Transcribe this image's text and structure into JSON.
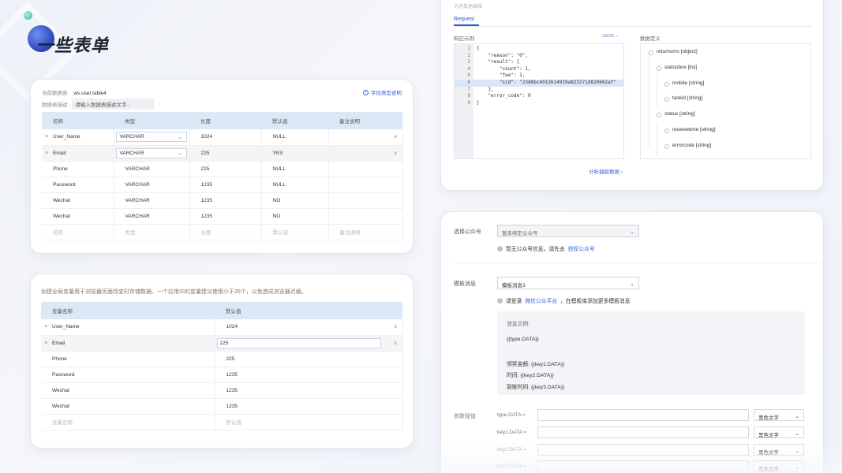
{
  "page": {
    "title": "一些表单"
  },
  "table_form": {
    "current_table_label": "当前数据表:",
    "current_table_value": "ws.user.table4",
    "desc_label": "数据表描述:",
    "desc_placeholder": "请输入数据表描述文字...",
    "help_link": "字段类型说明",
    "columns": [
      "名称",
      "类型",
      "长度",
      "默认值",
      "备注说明"
    ],
    "rows": [
      {
        "name": "User_Name",
        "type": "VARCHAR",
        "length": "1024",
        "default": "NULL",
        "note": ""
      },
      {
        "name": "Email",
        "type": "VARCHAR",
        "length": "225",
        "default": "YES",
        "note": ""
      },
      {
        "name": "Phone",
        "type": "VARCHAR",
        "length": "225",
        "default": "NULL",
        "note": ""
      },
      {
        "name": "Password",
        "type": "VARCHAR",
        "length": "1235",
        "default": "NULL",
        "note": ""
      },
      {
        "name": "Wechat",
        "type": "VARCHAR",
        "length": "1235",
        "default": "NO",
        "note": ""
      },
      {
        "name": "Wechat",
        "type": "VARCHAR",
        "length": "1235",
        "default": "NO",
        "note": ""
      }
    ],
    "placeholder_row": [
      "名称",
      "类型",
      "长度",
      "默认值",
      "备注说明"
    ]
  },
  "vars_form": {
    "note": "创建全局变量用于浏览器页面改变时存储数据。一个应用中的变量建议使用小于25个，以免造成浏览器迟缓。",
    "columns": [
      "变量名称",
      "默认值"
    ],
    "rows": [
      {
        "name": "User_Name",
        "value": "1024"
      },
      {
        "name": "Email",
        "value": "225"
      },
      {
        "name": "Phone",
        "value": "225"
      },
      {
        "name": "Password",
        "value": "1235"
      },
      {
        "name": "Wechat",
        "value": "1235"
      },
      {
        "name": "Wechat",
        "value": "1235"
      }
    ],
    "placeholder_row": [
      "变量名称",
      "默认值"
    ]
  },
  "api_panel": {
    "header": "消息数据编辑",
    "tab": "Request",
    "response_label": "响应示例",
    "format_select": "JSON",
    "definition_label": "数据定义",
    "code_lines": [
      "{",
      "    \"reason\": \"0\",",
      "    \"result\": {",
      "        \"count\": 1,",
      "        \"fee\": 1,",
      "        \"sid\": \"23d6bc4913614919a823271d820662af\"",
      "    },",
      "    \"error_code\": 0",
      "}"
    ],
    "highlight_line": 6,
    "tree": [
      {
        "label": "returnsms [object]",
        "depth": 0
      },
      {
        "label": "statusbox [list]",
        "depth": 1
      },
      {
        "label": "mobile [string]",
        "depth": 2
      },
      {
        "label": "taskid [string]",
        "depth": 2
      },
      {
        "label": "status [string]",
        "depth": 1
      },
      {
        "label": "receivetime [string]",
        "depth": 2
      },
      {
        "label": "errorcode [string]",
        "depth": 2
      }
    ],
    "extract_link": "分析抽取数据"
  },
  "wechat_form": {
    "account_label": "选择公众号",
    "account_value": "暂未绑定公众号",
    "account_info_prefix": "暂无公众号信息。请先去",
    "account_info_link": "授权公众号",
    "template_label": "模板消息",
    "template_value": "模板消息3",
    "template_info_prefix": "请登录",
    "template_info_link": "微信公众平台",
    "template_info_suffix": "，在模板库添加更多模板消息",
    "example_title": "消息示例:",
    "example_lines": [
      "{{type.DATA}}",
      "领奖金额: {{key1.DATA}}",
      "时间: {{key2.DATA}}",
      "到账时间: {{key3.DATA}}"
    ],
    "params_label": "参数赋值",
    "params": [
      {
        "name": "type.DATA",
        "color": "黑色文字"
      },
      {
        "name": "key1.DATA",
        "color": "黑色文字"
      },
      {
        "name": "key2.DATA",
        "color": "黑色文字"
      },
      {
        "name": "key2.DATA",
        "color": "黑色文字"
      }
    ]
  }
}
